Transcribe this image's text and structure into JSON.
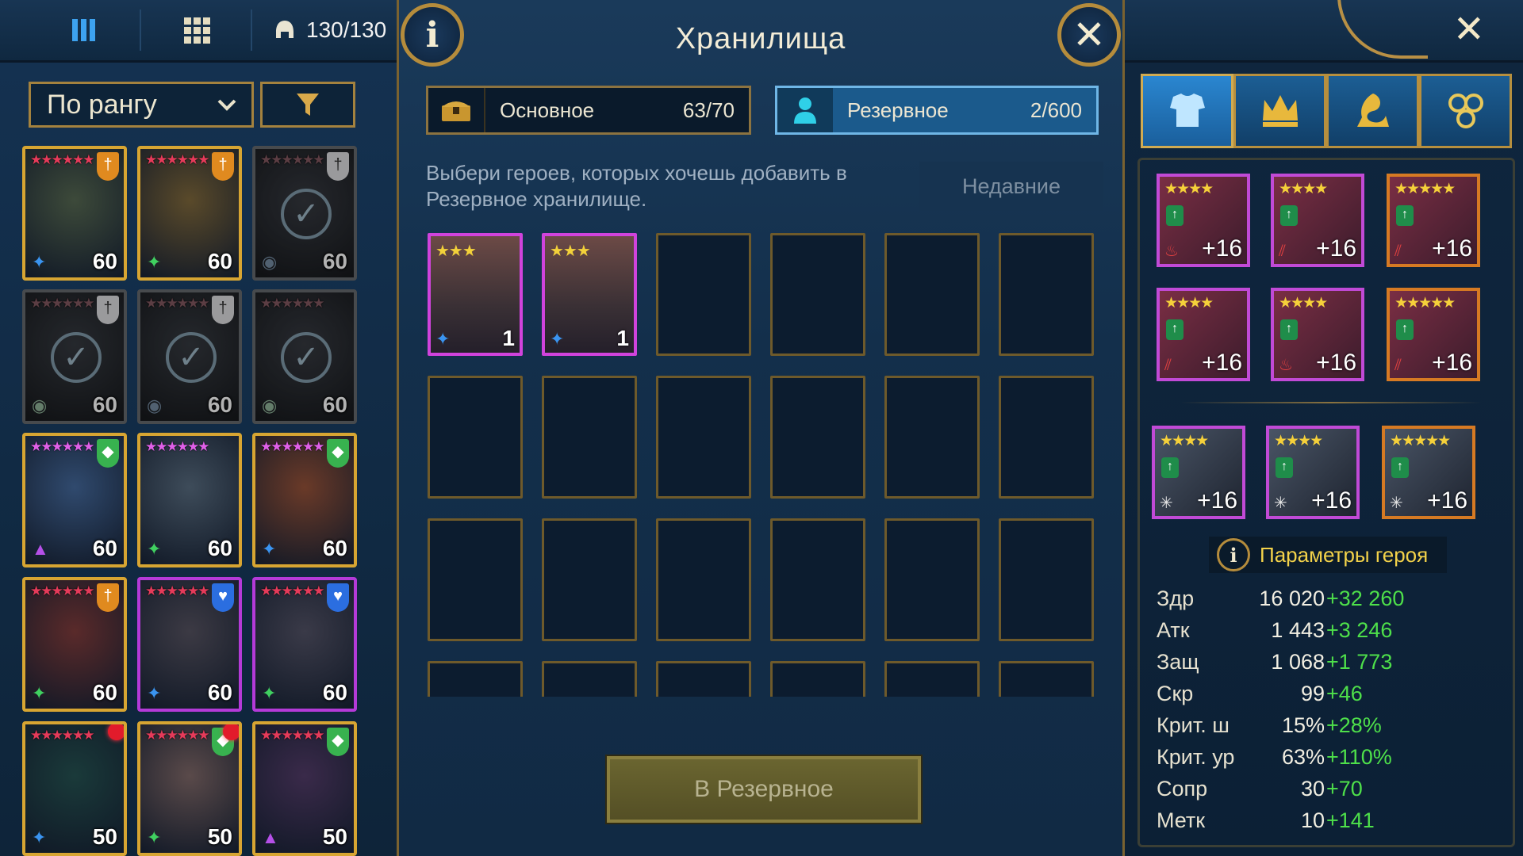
{
  "topbar": {
    "counter": "130/130",
    "icons": [
      "menu-bars-icon",
      "grid-icon",
      "helmet-icon",
      "close-icon"
    ],
    "accent": "#b58c3c"
  },
  "left_panel": {
    "sort_label": "По рангу",
    "heroes": [
      {
        "level": "60",
        "frame": "gold",
        "badge": "orange",
        "state": "normal"
      },
      {
        "level": "60",
        "frame": "gold",
        "badge": "orange",
        "state": "normal"
      },
      {
        "level": "60",
        "frame": "grey",
        "badge": "white",
        "state": "selected"
      },
      {
        "level": "60",
        "frame": "grey",
        "badge": "white",
        "state": "selected"
      },
      {
        "level": "60",
        "frame": "grey",
        "badge": "white",
        "state": "selected"
      },
      {
        "level": "60",
        "frame": "grey",
        "badge": "none",
        "state": "selected"
      },
      {
        "level": "60",
        "frame": "gold",
        "badge": "green",
        "state": "normal"
      },
      {
        "level": "60",
        "frame": "gold",
        "badge": "none",
        "state": "normal"
      },
      {
        "level": "60",
        "frame": "gold",
        "badge": "green",
        "state": "normal"
      },
      {
        "level": "60",
        "frame": "gold",
        "badge": "orange",
        "state": "normal"
      },
      {
        "level": "60",
        "frame": "purple",
        "badge": "blue",
        "state": "normal"
      },
      {
        "level": "60",
        "frame": "purple",
        "badge": "blue",
        "state": "normal"
      },
      {
        "level": "50",
        "frame": "gold",
        "badge": "none",
        "state": "new"
      },
      {
        "level": "50",
        "frame": "gold",
        "badge": "green",
        "state": "new"
      },
      {
        "level": "50",
        "frame": "gold",
        "badge": "green",
        "state": "normal"
      }
    ]
  },
  "dialog": {
    "title": "Хранилища",
    "tab_main": {
      "label": "Основное",
      "count": "63/70"
    },
    "tab_reserve": {
      "label": "Резервное",
      "count": "2/600"
    },
    "prompt": "Выбери героев, которых хочешь добавить в Резервное хранилище.",
    "recent_label": "Недавние",
    "selected": [
      {
        "count": "1"
      },
      {
        "count": "1"
      }
    ],
    "button_label": "В Резервное"
  },
  "right_panel": {
    "gear_tabs": [
      "armor-icon",
      "crown-icon",
      "mastery-icon",
      "blessings-icon"
    ],
    "gear": [
      {
        "plus": "+16",
        "rarity": "epic"
      },
      {
        "plus": "+16",
        "rarity": "epic"
      },
      {
        "plus": "+16",
        "rarity": "legendary"
      },
      {
        "plus": "+16",
        "rarity": "epic"
      },
      {
        "plus": "+16",
        "rarity": "epic"
      },
      {
        "plus": "+16",
        "rarity": "legendary"
      },
      {
        "plus": "+16",
        "rarity": "epic"
      },
      {
        "plus": "+16",
        "rarity": "epic"
      },
      {
        "plus": "+16",
        "rarity": "legendary"
      }
    ],
    "params_title": "Параметры героя",
    "stats": [
      {
        "name": "Здр",
        "value": "16 020",
        "bonus": "+32 260"
      },
      {
        "name": "Атк",
        "value": "1 443",
        "bonus": "+3 246"
      },
      {
        "name": "Защ",
        "value": "1 068",
        "bonus": "+1 773"
      },
      {
        "name": "Скр",
        "value": "99",
        "bonus": "+46"
      },
      {
        "name": "Крит. ш",
        "value": "15%",
        "bonus": "+28%"
      },
      {
        "name": "Крит. ур",
        "value": "63%",
        "bonus": "+110%"
      },
      {
        "name": "Сопр",
        "value": "30",
        "bonus": "+70"
      },
      {
        "name": "Метк",
        "value": "10",
        "bonus": "+141"
      }
    ],
    "bonus_color": "#4ee04a"
  }
}
